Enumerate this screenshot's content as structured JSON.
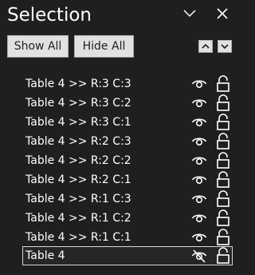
{
  "pane": {
    "title": "Selection",
    "collapse_icon": "chevron-down-icon",
    "close_icon": "close-icon"
  },
  "toolbar": {
    "show_all_label": "Show All",
    "hide_all_label": "Hide All",
    "bring_forward_icon": "chevron-up-icon",
    "send_backward_icon": "chevron-down-icon"
  },
  "items": [
    {
      "label": "Table 4 >> R:3 C:3",
      "visible": true,
      "locked": false,
      "selected": false
    },
    {
      "label": "Table 4 >> R:3 C:2",
      "visible": true,
      "locked": false,
      "selected": false
    },
    {
      "label": "Table 4 >> R:3 C:1",
      "visible": true,
      "locked": false,
      "selected": false
    },
    {
      "label": "Table 4 >> R:2 C:3",
      "visible": true,
      "locked": false,
      "selected": false
    },
    {
      "label": "Table 4 >> R:2 C:2",
      "visible": true,
      "locked": false,
      "selected": false
    },
    {
      "label": "Table 4 >> R:2 C:1",
      "visible": true,
      "locked": false,
      "selected": false
    },
    {
      "label": "Table 4 >> R:1 C:3",
      "visible": true,
      "locked": false,
      "selected": false
    },
    {
      "label": "Table 4 >> R:1 C:2",
      "visible": true,
      "locked": false,
      "selected": false
    },
    {
      "label": "Table 4 >> R:1 C:1",
      "visible": true,
      "locked": false,
      "selected": false
    },
    {
      "label": "Table 4",
      "visible": false,
      "locked": false,
      "selected": true
    }
  ],
  "colors": {
    "background": "#1f1f1f",
    "text": "#ffffff",
    "button_face": "#e1e1e1",
    "selection_border": "#d8d8d8"
  }
}
